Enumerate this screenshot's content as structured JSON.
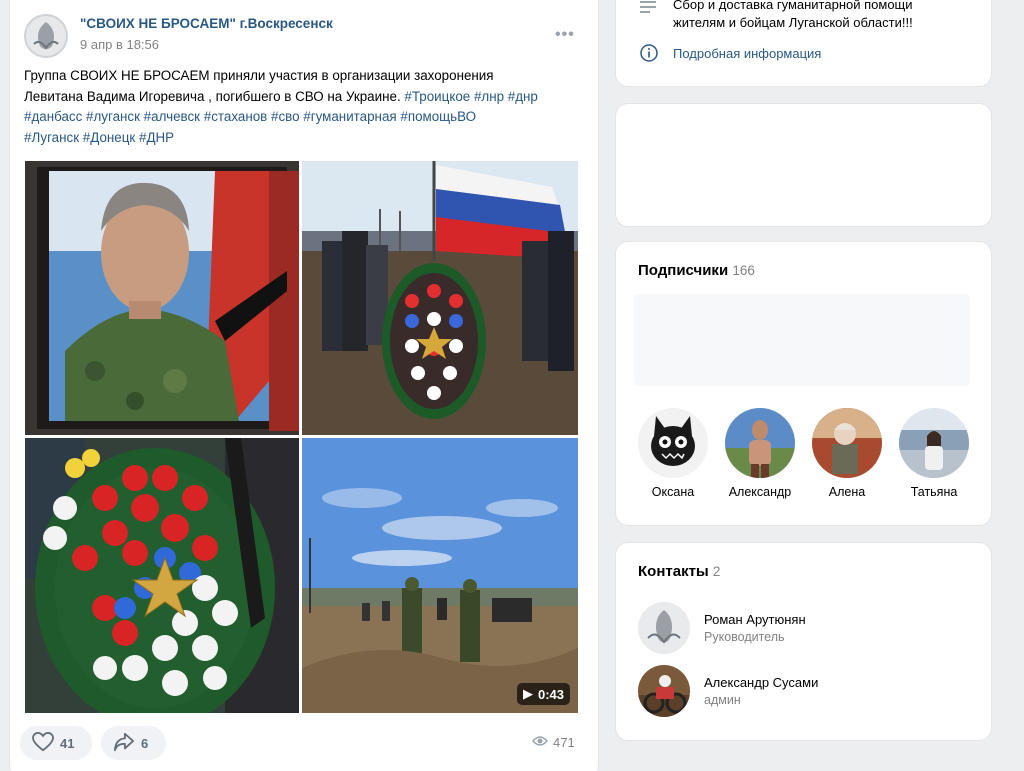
{
  "post": {
    "author": "\"СВОИХ НЕ БРОСАЕМ\" г.Воскресенск",
    "date": "9 апр в 18:56",
    "more": "•••",
    "text_line1": "Группа СВОИХ НЕ БРОСАЕМ приняли участия в организации захоронения",
    "text_line2": "Левитана Вадима Игоревича , погибшего в СВО на Украине.",
    "tags_line2": "#Троицкое #лнр #днр",
    "tags_line3": "#данбасс #луганск #алчевск #стаханов #сво #гуманитарная #помощьВО",
    "tags_line4": "#Луганск #Донецк #ДНР",
    "video_duration": "0:43",
    "likes": "41",
    "shares": "6",
    "views": "471"
  },
  "info": {
    "text_line1": "Сбор и доставка гуманитарной помощи",
    "text_line2": "жителям и бойцам Луганской области!!!",
    "more_link": "Подробная информация"
  },
  "subscribers": {
    "title": "Подписчики",
    "count": "166",
    "items": [
      {
        "name": "Оксана"
      },
      {
        "name": "Александр"
      },
      {
        "name": "Алена"
      },
      {
        "name": "Татьяна"
      }
    ]
  },
  "contacts": {
    "title": "Контакты",
    "count": "2",
    "items": [
      {
        "name": "Роман Арутюнян",
        "role": "Руководитель"
      },
      {
        "name": "Александр Сусами",
        "role": "админ"
      }
    ]
  },
  "colors": {
    "link": "#2a5885",
    "muted": "#828282",
    "background": "#edeef0"
  }
}
